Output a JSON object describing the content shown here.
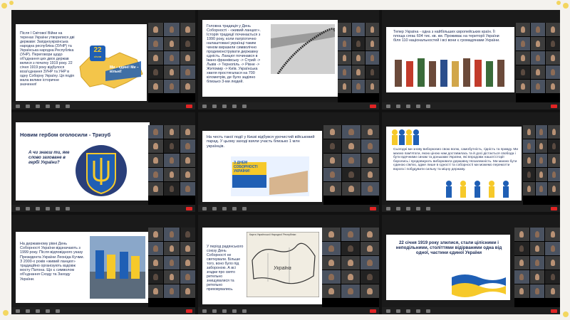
{
  "slides": {
    "p1": {
      "text": "Після І Світової Війни на теренах України утворилися дві держави: Західноукраїнська народна республіка (ЗУНР) та Українська народна Республіка (УНР). Переговори щодо об'єднання цих двох держав велися з початку 1919 року. 22 січня 1919 року відбулося возз'єднання ЗУНР та УНР в одну Соборну Україну. Ця подія мала велике історичне значення!",
      "badge_num": "22",
      "badge_word": "січня",
      "map_text": "Ми – єдині! Ми – вільні!"
    },
    "p2": {
      "text": "Головна традиція у День Соборності - «живий ланцюг». Історія традиції починається з 1990 року, коли патріотично налаштовані українці таким чином виразили символічно продемонструвати державну єдність. Ланцюг починався в Івано-франківську -> Стрий -> Львів -> Тернопіль -> Рівне -> Житомир -> Київ. Українська хвиля простягалася на 700 кілометрів, де було задіяно близько 3-ми людей."
    },
    "p3": {
      "text": "Тепер Україна - одна з найбільших європейських країн. Її площа сягає 604 тис. кв. км. Проживає на території України біля 110 національностей і всі вони є громадянами України."
    },
    "p4": {
      "title": "Новим гербом оголосили - Тризуб",
      "question": "А чи знаєш ти, яке слово заховане в гербі України?"
    },
    "p5": {
      "text": "На честь такої події у Києві відбувся урочистий військовий парад. У цьому заході взяли участь близько 1 млн українців.",
      "banner": "З ДНЕМ СОБОРНОСТІ УКРАЇНИ!"
    },
    "p6": {
      "text": "Сьогодні ми знову виборюємо свою волю, самобутність, гідність та правду. Ми маємо пам'ятати, якою ціною нам доставилась та й досі дістається свобода і бути вдячними синам та доньками України, які впродовж нашої історії боролись і продовжують виборювати державну Незалежність. Ми маємо бути єдиною сім'єю, адже лише в єдності та соборності ми можемо перемогти ворога і побудувати сильну та міцну державу."
    },
    "p7": {
      "text": "На державному рівні День Соборності України відзначають з 1999 року. Після відповідного указу Президента України Леоніда Кучми. З 2000-х років «живий ланцюг» традиційно організують вздовж мосту Патона. Що є символом об'єднання Сходу та Заходу України."
    },
    "p8": {
      "text": "У період радянського союзу День Соборності не святкували. Більше того, воно було під забороною. А всі згадки про свято ретельно знищувалися та ретельно приховувались.",
      "map_label": "Україна",
      "map_title": "Карта Української Народної Республіки"
    },
    "p9": {
      "text": "22 січня 1919 року злилися, стали цілісними і неподільними, століттями відірваними одна від одної, частини єдиної України"
    }
  },
  "colors": {
    "ua_blue": "#1f5fb5",
    "ua_yellow": "#f6c92a",
    "slide_text": "#1a2a55",
    "record_red": "#e02424"
  }
}
